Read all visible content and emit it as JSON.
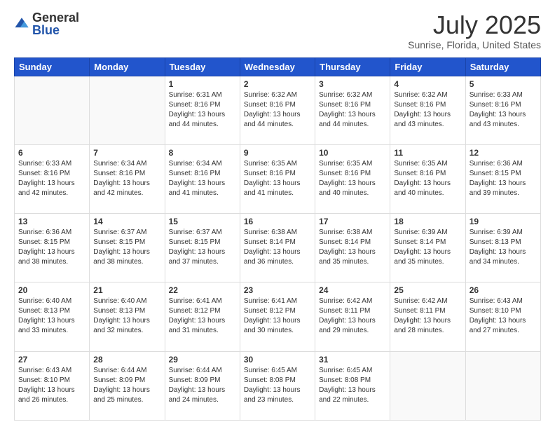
{
  "logo": {
    "general": "General",
    "blue": "Blue"
  },
  "header": {
    "month_year": "July 2025",
    "location": "Sunrise, Florida, United States"
  },
  "days_of_week": [
    "Sunday",
    "Monday",
    "Tuesday",
    "Wednesday",
    "Thursday",
    "Friday",
    "Saturday"
  ],
  "weeks": [
    [
      {
        "day": "",
        "info": ""
      },
      {
        "day": "",
        "info": ""
      },
      {
        "day": "1",
        "info": "Sunrise: 6:31 AM\nSunset: 8:16 PM\nDaylight: 13 hours and 44 minutes."
      },
      {
        "day": "2",
        "info": "Sunrise: 6:32 AM\nSunset: 8:16 PM\nDaylight: 13 hours and 44 minutes."
      },
      {
        "day": "3",
        "info": "Sunrise: 6:32 AM\nSunset: 8:16 PM\nDaylight: 13 hours and 44 minutes."
      },
      {
        "day": "4",
        "info": "Sunrise: 6:32 AM\nSunset: 8:16 PM\nDaylight: 13 hours and 43 minutes."
      },
      {
        "day": "5",
        "info": "Sunrise: 6:33 AM\nSunset: 8:16 PM\nDaylight: 13 hours and 43 minutes."
      }
    ],
    [
      {
        "day": "6",
        "info": "Sunrise: 6:33 AM\nSunset: 8:16 PM\nDaylight: 13 hours and 42 minutes."
      },
      {
        "day": "7",
        "info": "Sunrise: 6:34 AM\nSunset: 8:16 PM\nDaylight: 13 hours and 42 minutes."
      },
      {
        "day": "8",
        "info": "Sunrise: 6:34 AM\nSunset: 8:16 PM\nDaylight: 13 hours and 41 minutes."
      },
      {
        "day": "9",
        "info": "Sunrise: 6:35 AM\nSunset: 8:16 PM\nDaylight: 13 hours and 41 minutes."
      },
      {
        "day": "10",
        "info": "Sunrise: 6:35 AM\nSunset: 8:16 PM\nDaylight: 13 hours and 40 minutes."
      },
      {
        "day": "11",
        "info": "Sunrise: 6:35 AM\nSunset: 8:16 PM\nDaylight: 13 hours and 40 minutes."
      },
      {
        "day": "12",
        "info": "Sunrise: 6:36 AM\nSunset: 8:15 PM\nDaylight: 13 hours and 39 minutes."
      }
    ],
    [
      {
        "day": "13",
        "info": "Sunrise: 6:36 AM\nSunset: 8:15 PM\nDaylight: 13 hours and 38 minutes."
      },
      {
        "day": "14",
        "info": "Sunrise: 6:37 AM\nSunset: 8:15 PM\nDaylight: 13 hours and 38 minutes."
      },
      {
        "day": "15",
        "info": "Sunrise: 6:37 AM\nSunset: 8:15 PM\nDaylight: 13 hours and 37 minutes."
      },
      {
        "day": "16",
        "info": "Sunrise: 6:38 AM\nSunset: 8:14 PM\nDaylight: 13 hours and 36 minutes."
      },
      {
        "day": "17",
        "info": "Sunrise: 6:38 AM\nSunset: 8:14 PM\nDaylight: 13 hours and 35 minutes."
      },
      {
        "day": "18",
        "info": "Sunrise: 6:39 AM\nSunset: 8:14 PM\nDaylight: 13 hours and 35 minutes."
      },
      {
        "day": "19",
        "info": "Sunrise: 6:39 AM\nSunset: 8:13 PM\nDaylight: 13 hours and 34 minutes."
      }
    ],
    [
      {
        "day": "20",
        "info": "Sunrise: 6:40 AM\nSunset: 8:13 PM\nDaylight: 13 hours and 33 minutes."
      },
      {
        "day": "21",
        "info": "Sunrise: 6:40 AM\nSunset: 8:13 PM\nDaylight: 13 hours and 32 minutes."
      },
      {
        "day": "22",
        "info": "Sunrise: 6:41 AM\nSunset: 8:12 PM\nDaylight: 13 hours and 31 minutes."
      },
      {
        "day": "23",
        "info": "Sunrise: 6:41 AM\nSunset: 8:12 PM\nDaylight: 13 hours and 30 minutes."
      },
      {
        "day": "24",
        "info": "Sunrise: 6:42 AM\nSunset: 8:11 PM\nDaylight: 13 hours and 29 minutes."
      },
      {
        "day": "25",
        "info": "Sunrise: 6:42 AM\nSunset: 8:11 PM\nDaylight: 13 hours and 28 minutes."
      },
      {
        "day": "26",
        "info": "Sunrise: 6:43 AM\nSunset: 8:10 PM\nDaylight: 13 hours and 27 minutes."
      }
    ],
    [
      {
        "day": "27",
        "info": "Sunrise: 6:43 AM\nSunset: 8:10 PM\nDaylight: 13 hours and 26 minutes."
      },
      {
        "day": "28",
        "info": "Sunrise: 6:44 AM\nSunset: 8:09 PM\nDaylight: 13 hours and 25 minutes."
      },
      {
        "day": "29",
        "info": "Sunrise: 6:44 AM\nSunset: 8:09 PM\nDaylight: 13 hours and 24 minutes."
      },
      {
        "day": "30",
        "info": "Sunrise: 6:45 AM\nSunset: 8:08 PM\nDaylight: 13 hours and 23 minutes."
      },
      {
        "day": "31",
        "info": "Sunrise: 6:45 AM\nSunset: 8:08 PM\nDaylight: 13 hours and 22 minutes."
      },
      {
        "day": "",
        "info": ""
      },
      {
        "day": "",
        "info": ""
      }
    ]
  ]
}
